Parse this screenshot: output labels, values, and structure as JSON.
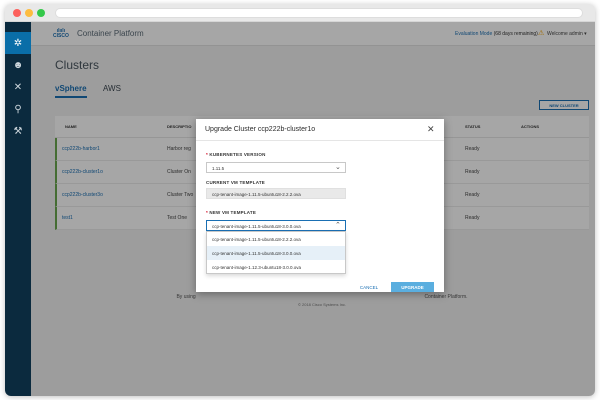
{
  "header": {
    "logo_top": "ılıılı",
    "logo_bottom": "CISCO",
    "product": "Container Platform",
    "eval_link": "Evaluation Mode",
    "eval_days": "(68 days remaining)",
    "welcome": "Welcome admin ▾"
  },
  "page": {
    "title": "Clusters",
    "tabs": [
      {
        "label": "vSphere"
      },
      {
        "label": "AWS"
      }
    ],
    "new_cluster": "NEW CLUSTER"
  },
  "table": {
    "headers": [
      "NAME",
      "DESCRIPTIO",
      "STATUS",
      "ACTIONS"
    ],
    "rows": [
      {
        "name": "ccp222b-harbor1",
        "desc": "Harbor reg",
        "status": "Ready"
      },
      {
        "name": "ccp222b-cluster1o",
        "desc": "Cluster On",
        "status": "Ready"
      },
      {
        "name": "ccp222b-cluster3o",
        "desc": "Cluster Two",
        "status": "Ready"
      },
      {
        "name": "test1",
        "desc": "Test One",
        "status": "Ready"
      }
    ]
  },
  "footer": {
    "left": "By using",
    "right": "Container Platform.",
    "copyright": "© 2018 Cisco Systems Inc."
  },
  "modal": {
    "title": "Upgrade Cluster ccp222b-cluster1o",
    "close": "✕",
    "k8s_label": "KUBERNETES VERSION",
    "k8s_value": "1.11.5",
    "current_label": "CURRENT VM TEMPLATE",
    "current_value": "ccp-tenant-image-1.11.5-ubuntu18-2.2.2.ova",
    "newvm_label": "NEW VM TEMPLATE",
    "newvm_value": "ccp-tenant-image-1.11.5-ubuntu18-3.0.0.ova",
    "options": [
      "ccp-tenant-image-1.11.5-ubuntu18-2.2.2.ova",
      "ccp-tenant-image-1.11.5-ubuntu18-3.0.0.ova",
      "ccp-tenant-image-1.12.3-ubuntu18-3.0.0.ova"
    ],
    "cancel": "CANCEL",
    "upgrade": "UPGRADE"
  },
  "icons": {
    "nav": [
      "cluster-icon",
      "users-icon",
      "tools-icon",
      "location-icon",
      "wrench-icon"
    ],
    "warning": "warning-icon"
  },
  "colors": {
    "accent": "#1a6fb3",
    "sidebar": "#0b2a3e",
    "upgrade_button": "#5aaedf",
    "status_bar": "#6aa84f"
  }
}
